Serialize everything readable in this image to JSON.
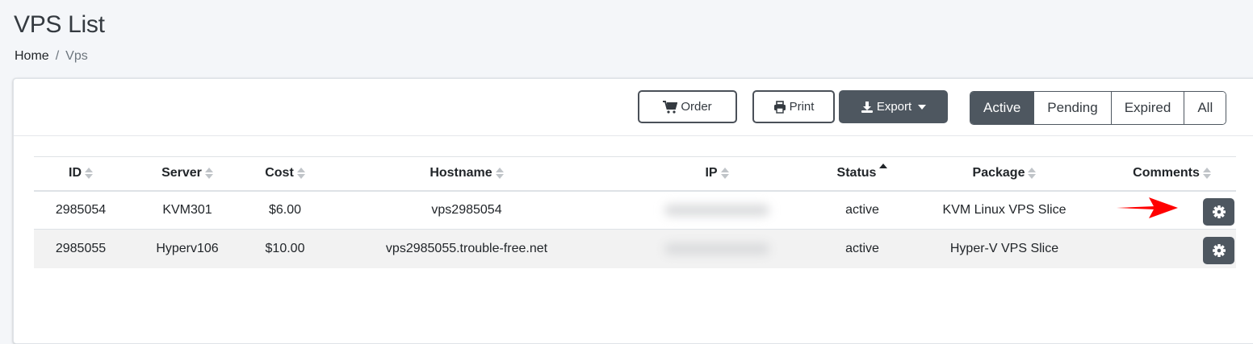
{
  "page": {
    "title": "VPS List",
    "breadcrumb": {
      "home": "Home",
      "separator": "/",
      "current": "Vps"
    }
  },
  "toolbar": {
    "order_label": "Order",
    "print_label": "Print",
    "export_label": "Export",
    "status_filters": [
      "Active",
      "Pending",
      "Expired",
      "All"
    ],
    "active_filter": "Active"
  },
  "table": {
    "columns": [
      "ID",
      "Server",
      "Cost",
      "Hostname",
      "IP",
      "Status",
      "Package",
      "Comments"
    ],
    "sorted_column": "Status",
    "rows": [
      {
        "id": "2985054",
        "server": "KVM301",
        "cost": "$6.00",
        "hostname": "vps2985054",
        "ip": "",
        "status": "active",
        "package": "KVM Linux VPS Slice",
        "comments": ""
      },
      {
        "id": "2985055",
        "server": "Hyperv106",
        "cost": "$10.00",
        "hostname": "vps2985055.trouble-free.net",
        "ip": "",
        "status": "active",
        "package": "Hyper-V VPS Slice",
        "comments": ""
      }
    ]
  },
  "icons": {
    "order": "cart-icon",
    "print": "printer-icon",
    "export": "download-icon",
    "row_action": "gear-icon",
    "annotation": "red-arrow-icon"
  },
  "colors": {
    "primary_dark": "#4e5760",
    "page_background": "#f4f6f9",
    "striped_row": "#f2f2f2",
    "annotation_arrow": "#ff0000"
  }
}
